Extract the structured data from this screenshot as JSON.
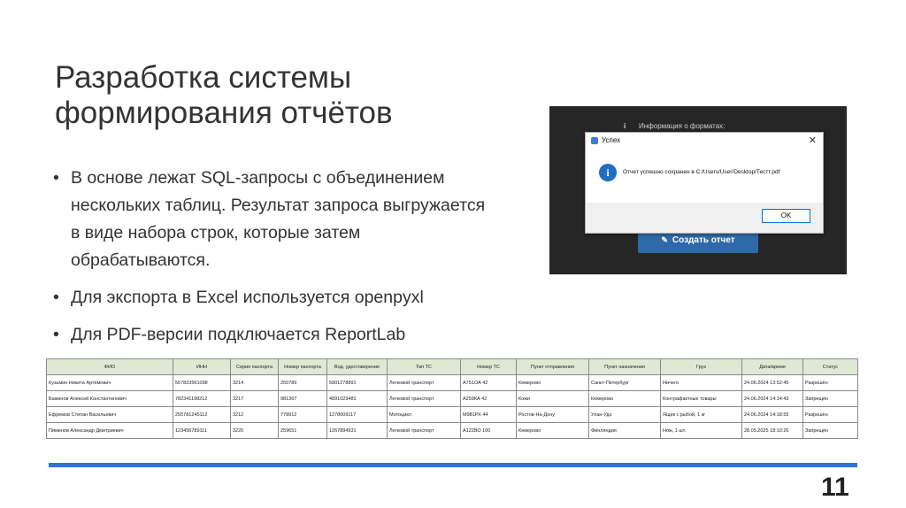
{
  "slide": {
    "title_line1": "Разработка системы",
    "title_line2": "формирования отчётов",
    "bullets": [
      "В основе лежат SQL-запросы с объединением нескольких таблиц. Результат запроса выгружается в виде набора строк, которые затем обрабатываются.",
      "Для экспорта в Excel используется openpyxl",
      "Для PDF-версии подключается ReportLab"
    ],
    "page_number": "11"
  },
  "screenshot": {
    "info_label": "Информация о форматах:",
    "info_icon": "i",
    "create_button": "Создать отчет",
    "dialog": {
      "title": "Успех",
      "message": "Отчет успешно сохранен в C:/Users/User/Desktop/Тестт.pdf",
      "ok": "OK",
      "close": "✕",
      "info_icon": "i"
    }
  },
  "table": {
    "headers": [
      "ФИО",
      "ИНН",
      "Серия паспорта",
      "Номер паспорта",
      "Вод. удостоверение",
      "Тип ТС",
      "Номер ТС",
      "Пункт отправления",
      "Пункт назначения",
      "Груз",
      "Дата/время",
      "Статус"
    ],
    "rows": [
      [
        "Кузьмин Никита Артёмович",
        "567823561098",
        "3214",
        "255789",
        "5901278891",
        "Легковой транспорт",
        "А751ОА 42",
        "Кемерово",
        "Санкт-Петербург",
        "Ничего",
        "24.06.2024 13:52:45",
        "Разрешён"
      ],
      [
        "Бажинов Алексей Константинович",
        "782341198212",
        "3217",
        "981367",
        "4891023481",
        "Легковой транспорт",
        "А259КА 42",
        "Кожи",
        "Кемерово",
        "Контрафактные товары",
        "24.06.2024 14:14:43",
        "Запрещён"
      ],
      [
        "Ефремов Степан Васильевич",
        "255781245112",
        "3212",
        "778912",
        "1278009117",
        "Мотоцикл",
        "М981РХ 44",
        "Ростов-На-Дону",
        "Улан-Удэ",
        "Ящик с рыбой, 1 кг",
        "24.06.2024 14:18:55",
        "Разрешён"
      ],
      [
        "Пименов Александр Дмитриевич",
        "123456789111",
        "3220",
        "259651",
        "1267894931",
        "Легковой транспорт",
        "А122ВО 100",
        "Кемерово",
        "Финляндия",
        "Нож, 1 шт.",
        "28.05.2025 18:10:26",
        "Запрещён"
      ]
    ]
  },
  "colors": {
    "accent": "#2b73d8",
    "table_header": "#dfe8d3",
    "dialog_icon": "#1f6fc4",
    "create_button": "#2f6aa8"
  }
}
